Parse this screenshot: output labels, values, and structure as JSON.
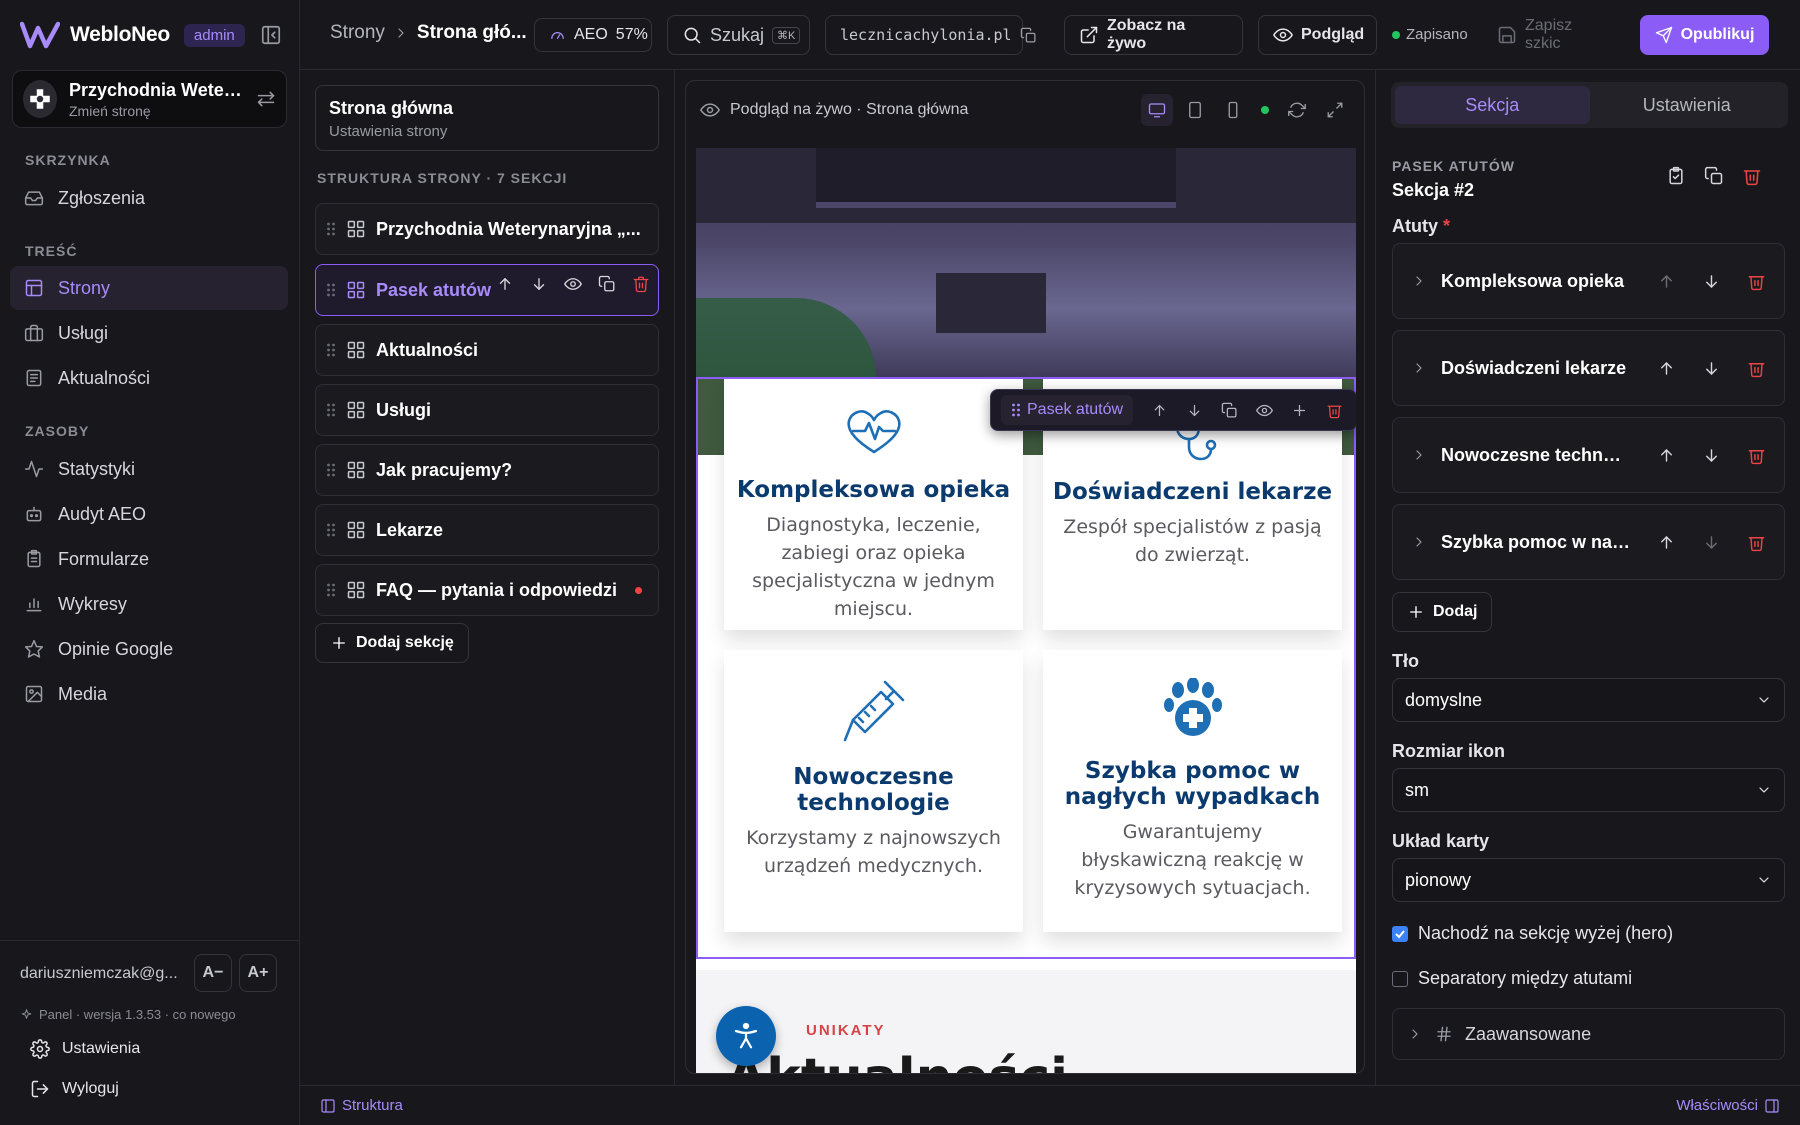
{
  "app": {
    "name": "WebloNeo",
    "role_badge": "admin"
  },
  "site": {
    "name": "Przychodnia Weterynaryjna",
    "switch_label": "Zmień stronę"
  },
  "sidebar": {
    "sections": [
      {
        "heading": "SKRZYNKA",
        "items": [
          {
            "label": "Zgłoszenia",
            "icon": "inbox-icon"
          }
        ]
      },
      {
        "heading": "TREŚĆ",
        "items": [
          {
            "label": "Strony",
            "icon": "layout-icon",
            "active": true
          },
          {
            "label": "Usługi",
            "icon": "briefcase-icon"
          },
          {
            "label": "Aktualności",
            "icon": "newspaper-icon"
          }
        ]
      },
      {
        "heading": "ZASOBY",
        "items": [
          {
            "label": "Statystyki",
            "icon": "activity-icon"
          },
          {
            "label": "Audyt AEO",
            "icon": "bot-icon"
          },
          {
            "label": "Formularze",
            "icon": "clipboard-icon"
          },
          {
            "label": "Wykresy",
            "icon": "bar-chart-icon"
          },
          {
            "label": "Opinie Google",
            "icon": "star-icon"
          },
          {
            "label": "Media",
            "icon": "image-icon"
          }
        ]
      }
    ],
    "user_email": "dariuszniemczak@g...",
    "font_decrease": "A−",
    "font_increase": "A+",
    "version_text": "Panel · wersja 1.3.53 · co nowego",
    "settings_label": "Ustawienia",
    "logout_label": "Wyloguj"
  },
  "topbar": {
    "breadcrumb": [
      "Strony",
      "Strona głó..."
    ],
    "aeo_label": "AEO",
    "aeo_value": "57%",
    "search_placeholder": "Szukaj",
    "search_shortcut": "⌘K",
    "domain": "lecznicachylonia.pl",
    "live_label": "Zobacz na żywo",
    "preview_label": "Podgląd",
    "saved_label": "Zapisano",
    "draft_label": "Zapisz szkic",
    "publish_label": "Opublikuj"
  },
  "structure": {
    "page_title": "Strona główna",
    "page_subtitle": "Ustawienia strony",
    "heading": "STRUKTURA STRONY · 7 SEKCJI",
    "sections": [
      {
        "label": "Przychodnia Weterynaryjna „..."
      },
      {
        "label": "Pasek atutów",
        "selected": true
      },
      {
        "label": "Aktualności"
      },
      {
        "label": "Usługi"
      },
      {
        "label": "Jak pracujemy?"
      },
      {
        "label": "Lekarze"
      },
      {
        "label": "FAQ — pytania i odpowiedzi",
        "warning": true
      }
    ],
    "add_label": "Dodaj sekcję"
  },
  "preview": {
    "header_label": "Podgląd na żywo · Strona główna",
    "floatbar_label": "Pasek atutów",
    "cards": [
      {
        "title": "Kompleksowa opieka",
        "text": "Diagnostyka, leczenie, zabiegi oraz opieka specjalistyczna w jednym miejscu.",
        "icon": "heart-pulse-icon"
      },
      {
        "title": "Doświadczeni lekarze",
        "text": "Zespół specjalistów z pasją do zwierząt.",
        "icon": "stethoscope-icon"
      },
      {
        "title": "Nowoczesne technologie",
        "text": "Korzystamy z najnowszych urządzeń medycznych.",
        "icon": "syringe-icon"
      },
      {
        "title": "Szybka pomoc w nagłych wypadkach",
        "text": "Gwarantujemy błyskawiczną reakcję w kryzysowych sytuacjach.",
        "icon": "paw-plus-icon"
      }
    ],
    "news_kicker": "UNIKATY",
    "news_title": "Aktualności"
  },
  "props": {
    "tabs": [
      "Sekcja",
      "Ustawienia"
    ],
    "kicker": "PASEK ATUTÓW",
    "title": "Sekcja #2",
    "atuty_label": "Atuty",
    "required_mark": "*",
    "atuty": [
      "Kompleksowa opieka",
      "Doświadczeni lekarze",
      "Nowoczesne technol...",
      "Szybka pomoc w nag..."
    ],
    "add_label": "Dodaj",
    "bg_label": "Tło",
    "bg_value": "domyslne",
    "icon_size_label": "Rozmiar ikon",
    "icon_size_value": "sm",
    "card_layout_label": "Układ karty",
    "card_layout_value": "pionowy",
    "overlap_label": "Nachodź na sekcję wyżej (hero)",
    "overlap_checked": true,
    "separators_label": "Separatory między atutami",
    "separators_checked": false,
    "advanced_label": "Zaawansowane"
  },
  "statusbar": {
    "left_label": "Struktura",
    "right_label": "Właściwości"
  },
  "colors": {
    "accent": "#8b5cf6",
    "accent_text": "#a78bfa",
    "danger": "#ef4444",
    "success": "#22c55e",
    "brand_blue": "#0b3a6e"
  }
}
